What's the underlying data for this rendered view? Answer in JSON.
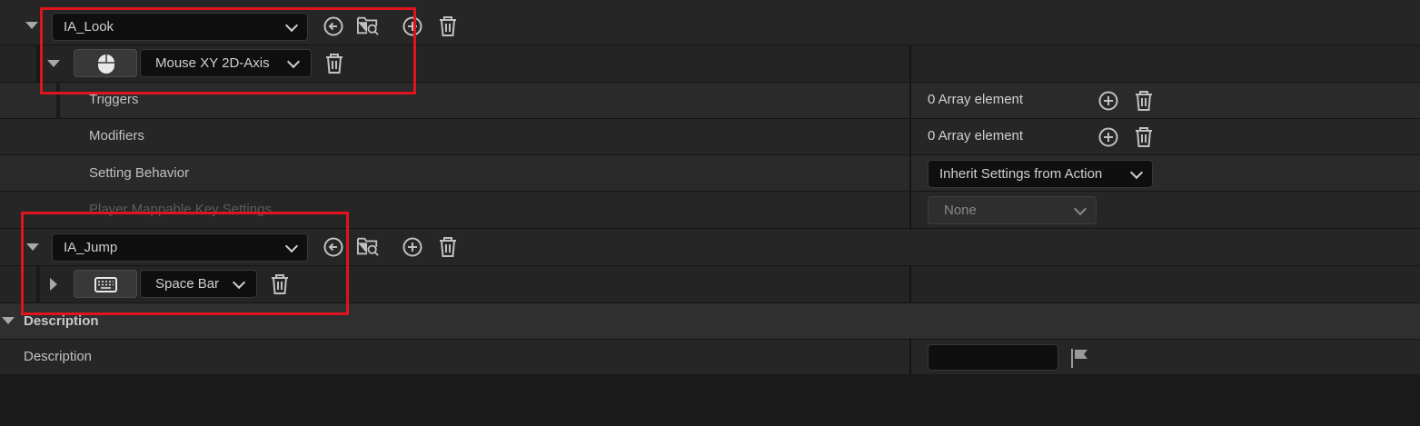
{
  "mappings": [
    {
      "action": "IA_Look",
      "key_label": "Mouse XY 2D-Axis",
      "key_icon": "mouse-icon"
    },
    {
      "action": "IA_Jump",
      "key_label": "Space Bar",
      "key_icon": "keyboard-icon"
    }
  ],
  "properties": {
    "triggers": {
      "label": "Triggers",
      "value": "0 Array element"
    },
    "modifiers": {
      "label": "Modifiers",
      "value": "0 Array element"
    },
    "setting_behavior": {
      "label": "Setting Behavior",
      "value": "Inherit Settings from Action"
    },
    "player_mappable": {
      "label": "Player Mappable Key Settings",
      "value": "None"
    }
  },
  "description_section": {
    "header": "Description",
    "label": "Description",
    "value": ""
  },
  "colors": {
    "highlight": "#e0141e",
    "panel": "#242424",
    "input_bg": "#0f0f0f"
  }
}
